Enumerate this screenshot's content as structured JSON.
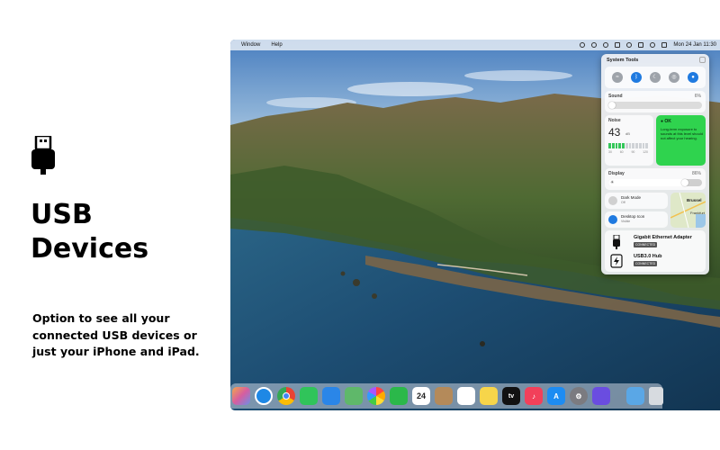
{
  "promo": {
    "title_line1": "USB",
    "title_line2": "Devices",
    "body": "Option to see all your connected USB devices or just your iPhone and iPad.",
    "usb_icon": "usb-stick-icon"
  },
  "menubar": {
    "items": [
      "Window",
      "Help"
    ],
    "clock": "Mon 24 Jan 11:30",
    "status_icons": [
      "moon-icon",
      "volume-icon",
      "bluetooth-icon",
      "clipboard-icon",
      "wifi-icon",
      "tools-icon",
      "search-icon",
      "control-center-icon"
    ]
  },
  "panel": {
    "title": "System Tools",
    "toggles": [
      {
        "icon": "wifi-icon",
        "on": false
      },
      {
        "icon": "bluetooth-icon",
        "on": true
      },
      {
        "icon": "moon-icon",
        "on": false
      },
      {
        "icon": "airdrop-icon",
        "on": false
      },
      {
        "icon": "microphone-icon",
        "on": true
      }
    ],
    "sound": {
      "label": "Sound",
      "value": "6%",
      "level": 0.06
    },
    "noise": {
      "label": "Noise",
      "value": "43",
      "unit": "dB",
      "scale": [
        "30",
        "60",
        "90",
        "120"
      ],
      "level": 0.36
    },
    "ok": {
      "title": "OK",
      "message": "Long-term exposure to sounds at this level should not affect your hearing."
    },
    "display": {
      "label": "Display",
      "value": "86%",
      "level": 0.86
    },
    "dark_mode": {
      "title": "Dark Mode",
      "state": "Off"
    },
    "desktop_icon": {
      "title": "Desktop Icon",
      "state": "Visible"
    },
    "map": {
      "city1": "Brussel",
      "city2": "Frankfurt"
    },
    "devices": [
      {
        "name": "Gigabit Ethernet Adapter",
        "status": "CONNECTED",
        "icon": "usb-plug-icon"
      },
      {
        "name": "USB3.0 Hub",
        "status": "CONNECTED",
        "icon": "lightning-icon"
      }
    ]
  },
  "dock": {
    "calendar_day": "24",
    "appletv_label": "tv",
    "apps": [
      {
        "name": "launchpad-icon",
        "color": "#e89b45"
      },
      {
        "name": "safari-icon",
        "color": "#1e88e5"
      },
      {
        "name": "chrome-icon",
        "color": "#ffffff"
      },
      {
        "name": "messages-icon",
        "color": "#30c45a"
      },
      {
        "name": "mail-icon",
        "color": "#2a86e8"
      },
      {
        "name": "maps-icon",
        "color": "#5fb86a"
      },
      {
        "name": "photos-icon",
        "color": "#ffffff"
      },
      {
        "name": "facetime-icon",
        "color": "#2bb84a"
      },
      {
        "name": "calendar-icon",
        "color": "#ffffff"
      },
      {
        "name": "contacts-icon",
        "color": "#b48a5a"
      },
      {
        "name": "reminders-icon",
        "color": "#ffffff"
      },
      {
        "name": "notes-icon",
        "color": "#f7d54a"
      },
      {
        "name": "appletv-icon",
        "color": "#111111"
      },
      {
        "name": "music-icon",
        "color": "#f2405a"
      },
      {
        "name": "appstore-icon",
        "color": "#1d8cf2"
      },
      {
        "name": "system-preferences-icon",
        "color": "#7b7b80"
      },
      {
        "name": "shortcuts-icon",
        "color": "#6a4de0"
      },
      {
        "name": "downloads-folder-icon",
        "color": "#5aa7e6"
      },
      {
        "name": "trash-icon",
        "color": "#d7dbe0"
      }
    ]
  }
}
